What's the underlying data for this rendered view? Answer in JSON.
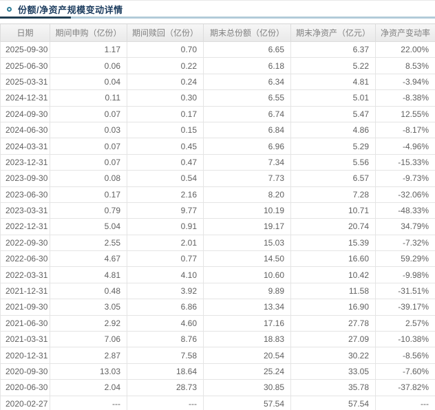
{
  "section": {
    "title": "份额/净资产规模变动详情",
    "bullet_icon": "circle-ring-icon"
  },
  "colors": {
    "title_text": "#1c3c5e",
    "bullet_ring": "#2e7d98",
    "underline_dark": "#1f3e52",
    "underline_light": "#b2cbd9",
    "header_text": "#808080",
    "cell_text": "#5f5f5f",
    "grid_border": "#e4e4e4"
  },
  "table": {
    "columns": [
      {
        "key": "date",
        "label": "日期"
      },
      {
        "key": "purchase",
        "label": "期间申购（亿份）"
      },
      {
        "key": "redemption",
        "label": "期间赎回（亿份）"
      },
      {
        "key": "total-shares",
        "label": "期末总份额（亿份）"
      },
      {
        "key": "net-assets",
        "label": "期末净资产（亿元）"
      },
      {
        "key": "change-rate",
        "label": "净资产变动率"
      }
    ],
    "rows": [
      [
        "2025-09-30",
        "1.17",
        "0.70",
        "6.65",
        "6.37",
        "22.00%"
      ],
      [
        "2025-06-30",
        "0.06",
        "0.22",
        "6.18",
        "5.22",
        "8.53%"
      ],
      [
        "2025-03-31",
        "0.04",
        "0.24",
        "6.34",
        "4.81",
        "-3.94%"
      ],
      [
        "2024-12-31",
        "0.11",
        "0.30",
        "6.55",
        "5.01",
        "-8.38%"
      ],
      [
        "2024-09-30",
        "0.07",
        "0.17",
        "6.74",
        "5.47",
        "12.55%"
      ],
      [
        "2024-06-30",
        "0.03",
        "0.15",
        "6.84",
        "4.86",
        "-8.17%"
      ],
      [
        "2024-03-31",
        "0.07",
        "0.45",
        "6.96",
        "5.29",
        "-4.96%"
      ],
      [
        "2023-12-31",
        "0.07",
        "0.47",
        "7.34",
        "5.56",
        "-15.33%"
      ],
      [
        "2023-09-30",
        "0.08",
        "0.54",
        "7.73",
        "6.57",
        "-9.73%"
      ],
      [
        "2023-06-30",
        "0.17",
        "2.16",
        "8.20",
        "7.28",
        "-32.06%"
      ],
      [
        "2023-03-31",
        "0.79",
        "9.77",
        "10.19",
        "10.71",
        "-48.33%"
      ],
      [
        "2022-12-31",
        "5.04",
        "0.91",
        "19.17",
        "20.74",
        "34.79%"
      ],
      [
        "2022-09-30",
        "2.55",
        "2.01",
        "15.03",
        "15.39",
        "-7.32%"
      ],
      [
        "2022-06-30",
        "4.67",
        "0.77",
        "14.50",
        "16.60",
        "59.29%"
      ],
      [
        "2022-03-31",
        "4.81",
        "4.10",
        "10.60",
        "10.42",
        "-9.98%"
      ],
      [
        "2021-12-31",
        "0.48",
        "3.92",
        "9.89",
        "11.58",
        "-31.51%"
      ],
      [
        "2021-09-30",
        "3.05",
        "6.86",
        "13.34",
        "16.90",
        "-39.17%"
      ],
      [
        "2021-06-30",
        "2.92",
        "4.60",
        "17.16",
        "27.78",
        "2.57%"
      ],
      [
        "2021-03-31",
        "7.06",
        "8.76",
        "18.83",
        "27.09",
        "-10.38%"
      ],
      [
        "2020-12-31",
        "2.87",
        "7.58",
        "20.54",
        "30.22",
        "-8.56%"
      ],
      [
        "2020-09-30",
        "13.03",
        "18.64",
        "25.24",
        "33.05",
        "-7.60%"
      ],
      [
        "2020-06-30",
        "2.04",
        "28.73",
        "30.85",
        "35.78",
        "-37.82%"
      ],
      [
        "2020-02-27",
        "---",
        "---",
        "57.54",
        "57.54",
        "---"
      ]
    ]
  }
}
